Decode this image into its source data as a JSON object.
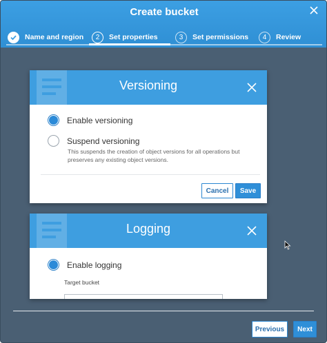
{
  "dialog": {
    "title": "Create bucket",
    "steps": [
      {
        "number": "1",
        "label": "Name and region",
        "state": "completed"
      },
      {
        "number": "2",
        "label": "Set properties",
        "state": "active"
      },
      {
        "number": "3",
        "label": "Set permissions",
        "state": "upcoming"
      },
      {
        "number": "4",
        "label": "Review",
        "state": "upcoming"
      }
    ]
  },
  "versioning": {
    "title": "Versioning",
    "options": [
      {
        "label": "Enable versioning",
        "checked": true
      },
      {
        "label": "Suspend versioning",
        "checked": false,
        "description": "This suspends the creation of object versions for all operations but preserves any existing object versions."
      }
    ],
    "cancel_label": "Cancel",
    "save_label": "Save"
  },
  "logging": {
    "title": "Logging",
    "option": {
      "label": "Enable logging",
      "checked": true
    },
    "target_bucket_label": "Target bucket",
    "target_bucket_value": ""
  },
  "footer": {
    "previous_label": "Previous",
    "next_label": "Next"
  },
  "colors": {
    "header_blue": "#3c9fe3",
    "backdrop": "#4a5f73",
    "primary_button": "#2f8fd8"
  },
  "icons": [
    "close-icon",
    "check-icon",
    "radio-selected-icon",
    "radio-unselected-icon",
    "mouse-pointer-icon"
  ]
}
